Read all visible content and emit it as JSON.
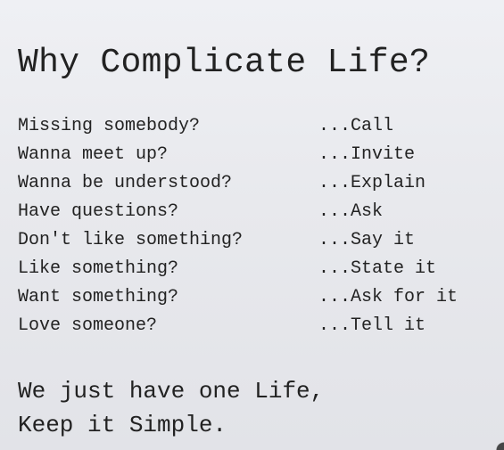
{
  "title": "Why Complicate Life?",
  "items": [
    {
      "question": "Missing somebody?",
      "answer": "...Call"
    },
    {
      "question": "Wanna meet up?",
      "answer": "...Invite"
    },
    {
      "question": "Wanna be understood?",
      "answer": "...Explain"
    },
    {
      "question": "Have questions?",
      "answer": "...Ask"
    },
    {
      "question": "Don't like something?",
      "answer": "...Say it"
    },
    {
      "question": "Like something?",
      "answer": "...State it"
    },
    {
      "question": "Want something?",
      "answer": "...Ask for it"
    },
    {
      "question": "Love someone?",
      "answer": "...Tell it"
    }
  ],
  "footer": {
    "line1": "We just have one Life,",
    "line2": "Keep it Simple."
  }
}
